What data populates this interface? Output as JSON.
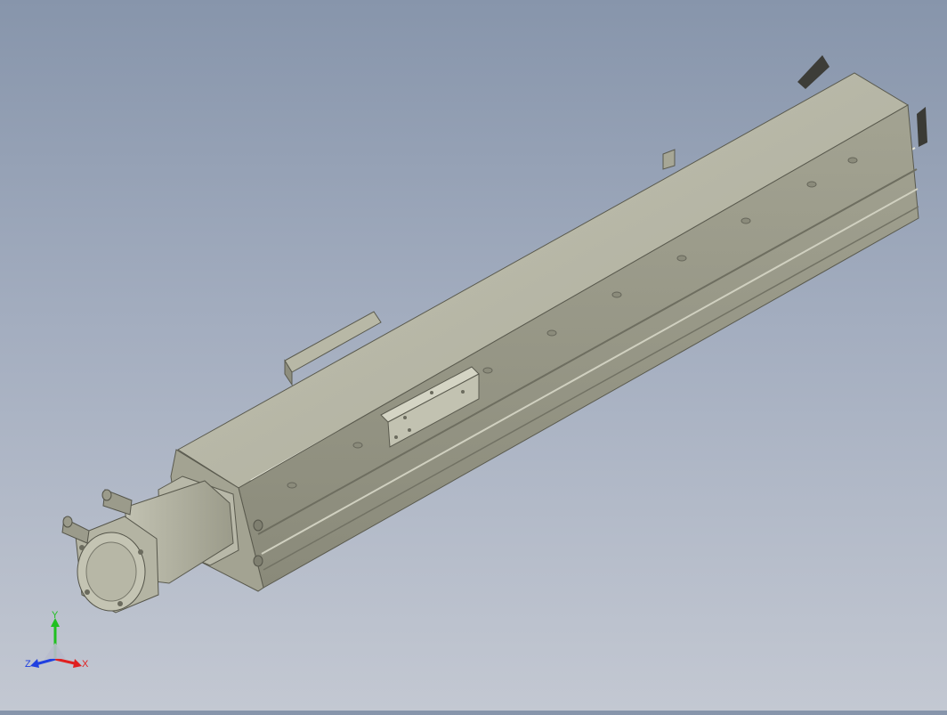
{
  "viewport": {
    "background_top": "#8795ab",
    "background_bottom": "#c3c8d2",
    "part_color": "#b1b1a0"
  },
  "triad": {
    "x_label": "X",
    "y_label": "Y",
    "z_label": "Z",
    "x_color": "#e02020",
    "y_color": "#20c020",
    "z_color": "#2040e0"
  }
}
